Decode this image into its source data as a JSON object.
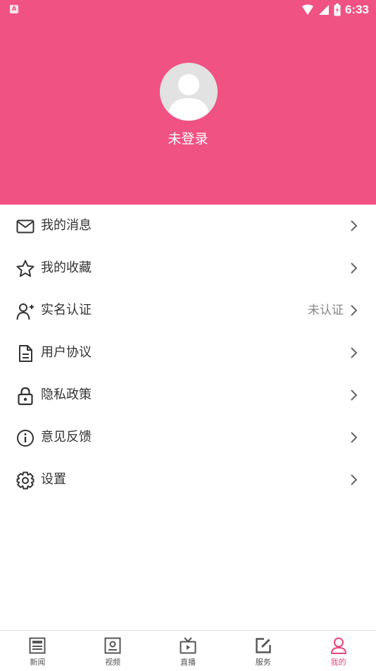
{
  "status_bar": {
    "time": "6:33",
    "left_badge": "A"
  },
  "profile": {
    "login_text": "未登录"
  },
  "menu": [
    {
      "id": "messages",
      "label": "我的消息",
      "icon": "mail-icon",
      "status": ""
    },
    {
      "id": "favorites",
      "label": "我的收藏",
      "icon": "star-icon",
      "status": ""
    },
    {
      "id": "verify",
      "label": "实名认证",
      "icon": "add-user-icon",
      "status": "未认证"
    },
    {
      "id": "agreement",
      "label": "用户协议",
      "icon": "document-icon",
      "status": ""
    },
    {
      "id": "privacy",
      "label": "隐私政策",
      "icon": "lock-icon",
      "status": ""
    },
    {
      "id": "feedback",
      "label": "意见反馈",
      "icon": "info-icon",
      "status": ""
    },
    {
      "id": "settings",
      "label": "设置",
      "icon": "gear-icon",
      "status": ""
    }
  ],
  "tabs": [
    {
      "label": "新闻",
      "icon": "newspaper-icon",
      "active": false
    },
    {
      "label": "视频",
      "icon": "video-icon",
      "active": false
    },
    {
      "label": "直播",
      "icon": "tv-icon",
      "active": false
    },
    {
      "label": "服务",
      "icon": "edit-icon",
      "active": false
    },
    {
      "label": "我的",
      "icon": "person-icon",
      "active": true
    }
  ],
  "colors": {
    "accent": "#f05284",
    "tab_active": "#e8467a",
    "text": "#333333",
    "muted": "#888888"
  }
}
